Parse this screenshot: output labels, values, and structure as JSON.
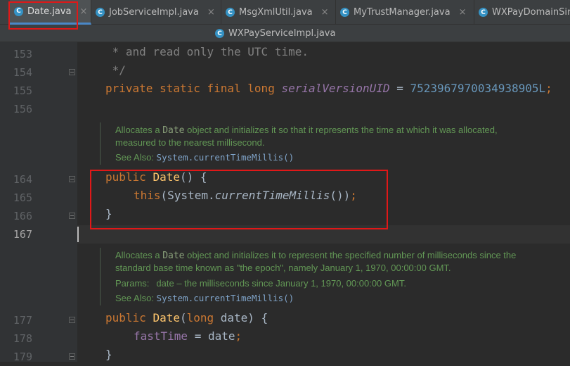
{
  "tabs": [
    {
      "label": "Date.java",
      "icon": "C",
      "active": true
    },
    {
      "label": "JobServiceImpl.java",
      "icon": "C"
    },
    {
      "label": "MsgXmlUtil.java",
      "icon": "C"
    },
    {
      "label": "MyTrustManager.java",
      "icon": "C"
    },
    {
      "label": "WXPayDomainSir",
      "icon": "C"
    }
  ],
  "tab_close": "×",
  "second_row_tab": {
    "label": "WXPayServiceImpl.java",
    "icon": "C"
  },
  "line_numbers": {
    "l153": "153",
    "l154": "154",
    "l155": "155",
    "l156": "156",
    "l164": "164",
    "l165": "165",
    "l166": "166",
    "l167": "167",
    "l177": "177",
    "l178": "178",
    "l179": "179"
  },
  "code": {
    "l153": " * and read only the UTC time.",
    "l154": " */",
    "l155_kw": "private static final long ",
    "l155_field": "serialVersionUID",
    "l155_eq": " = ",
    "l155_num": "7523967970034938905L",
    "l155_semi": ";",
    "l164_kw": "public ",
    "l164_fn": "Date",
    "l164_rest": "() {",
    "l165_kw": "this",
    "l165_a": "(System.",
    "l165_it": "currentTimeMillis",
    "l165_b": "())",
    "l165_semi": ";",
    "l166": "}",
    "l177_kw": "public ",
    "l177_fn": "Date",
    "l177_a": "(",
    "l177_kw2": "long",
    "l177_b": " date) {",
    "l178_a": "fastTime",
    "l178_b": " = date",
    "l178_semi": ";",
    "l179": "}"
  },
  "doc1": {
    "line1_a": "Allocates a ",
    "line1_code": "Date",
    "line1_b": " object and initializes it so that it represents the time at which it was allocated,",
    "line2": "measured to the nearest millisecond.",
    "see_also_label": "See Also: ",
    "see_also_link": "System.currentTimeMillis()"
  },
  "doc2": {
    "line1_a": "Allocates a ",
    "line1_code": "Date",
    "line1_b": " object and initializes it to represent the specified number of milliseconds since the",
    "line2": "standard base time known as \"the epoch\", namely January 1, 1970, 00:00:00 GMT.",
    "params_label": "Params:",
    "params_text": "date – the milliseconds since January 1, 1970, 00:00:00 GMT.",
    "see_also_label": "See Also: ",
    "see_also_link": "System.currentTimeMillis()"
  },
  "colors": {
    "highlight_box": "#e01818",
    "keyword": "#cc7832",
    "javadoc": "#629755"
  }
}
